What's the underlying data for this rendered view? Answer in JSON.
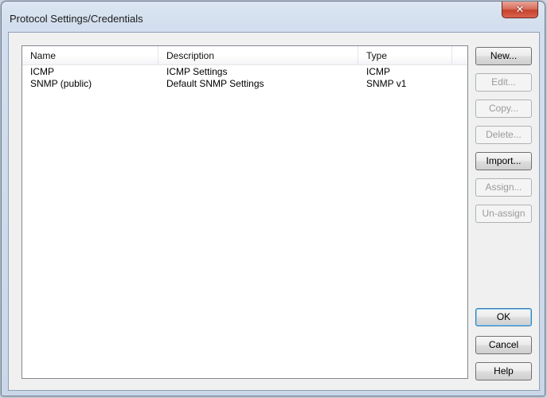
{
  "window": {
    "title": "Protocol Settings/Credentials",
    "close_glyph": "✕"
  },
  "list": {
    "columns": [
      "Name",
      "Description",
      "Type"
    ],
    "rows": [
      {
        "name": "ICMP",
        "description": "ICMP Settings",
        "type": "ICMP"
      },
      {
        "name": "SNMP (public)",
        "description": "Default SNMP Settings",
        "type": "SNMP v1"
      }
    ]
  },
  "buttons": {
    "new": "New...",
    "edit": "Edit...",
    "copy": "Copy...",
    "delete": "Delete...",
    "import": "Import...",
    "assign": "Assign...",
    "unassign": "Un-assign",
    "ok": "OK",
    "cancel": "Cancel",
    "help": "Help"
  },
  "colors": {
    "close_button": "#c7422c",
    "default_button_border": "#3c7fb1",
    "disabled_text": "#9a9a9a"
  }
}
